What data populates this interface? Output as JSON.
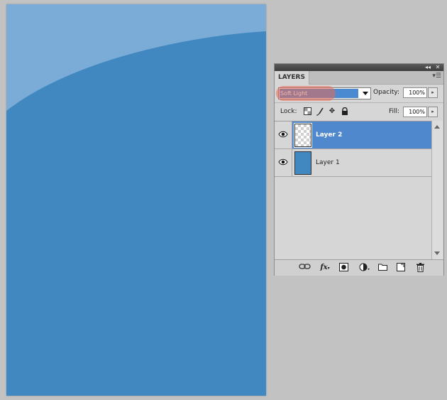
{
  "panel": {
    "tab_label": "LAYERS",
    "collapse_icon": "double-chevron-right",
    "close_icon": "close",
    "menu_icon": "panel-menu"
  },
  "blend": {
    "mode": "Soft Light",
    "opacity_label": "Opacity:",
    "opacity_value": "100%",
    "highlight_color": "#eb6955"
  },
  "lock": {
    "label": "Lock:",
    "icons": [
      "lock-transparent-pixels",
      "lock-image-pixels",
      "lock-position",
      "lock-all"
    ]
  },
  "fill": {
    "label": "Fill:",
    "value": "100%"
  },
  "layers": [
    {
      "name": "Layer 2",
      "selected": true,
      "visible": true,
      "thumbnail": "transparent"
    },
    {
      "name": "Layer 1",
      "selected": false,
      "visible": true,
      "thumbnail": "blue"
    }
  ],
  "bottom_icons": [
    "link-layers",
    "fx",
    "add-mask",
    "adjustment-layer",
    "new-group",
    "new-layer",
    "delete-layer"
  ],
  "colors": {
    "background": "#c2c2c2",
    "canvas_dark": "#4088bf",
    "canvas_light": "#7bacd8",
    "selection": "#4f88cc"
  }
}
